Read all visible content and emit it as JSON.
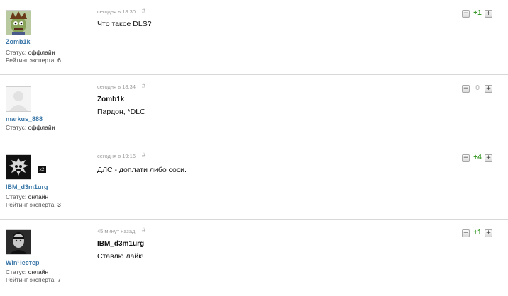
{
  "labels": {
    "status": "Статус:",
    "rating": "Рейтинг эксперта:",
    "anchor": "#"
  },
  "vote_buttons": {
    "minus": "−",
    "plus": "+"
  },
  "comments": [
    {
      "username": "Zomb1k",
      "status": "оффлайн",
      "rating": "6",
      "timestamp": "сегодня в 18:30",
      "reply_to": "",
      "text": "Что такое DLS?",
      "score": "+1"
    },
    {
      "username": "markus_888",
      "status": "оффлайн",
      "rating": "",
      "timestamp": "сегодня в 18:34",
      "reply_to": "Zomb1k",
      "text": "Пардон, *DLC",
      "score": "0"
    },
    {
      "username": "IBM_d3m1urg",
      "status": "онлайн",
      "rating": "3",
      "timestamp": "сегодня в 19:16",
      "reply_to": "",
      "text": "ДЛС - доплати либо соси.",
      "score": "+4",
      "badge": "x2"
    },
    {
      "username": "WinЧестер",
      "status": "онлайн",
      "rating": "7",
      "timestamp": "45 минут назад",
      "reply_to": "IBM_d3m1urg",
      "text": "Ставлю лайк!",
      "score": "+1"
    }
  ]
}
